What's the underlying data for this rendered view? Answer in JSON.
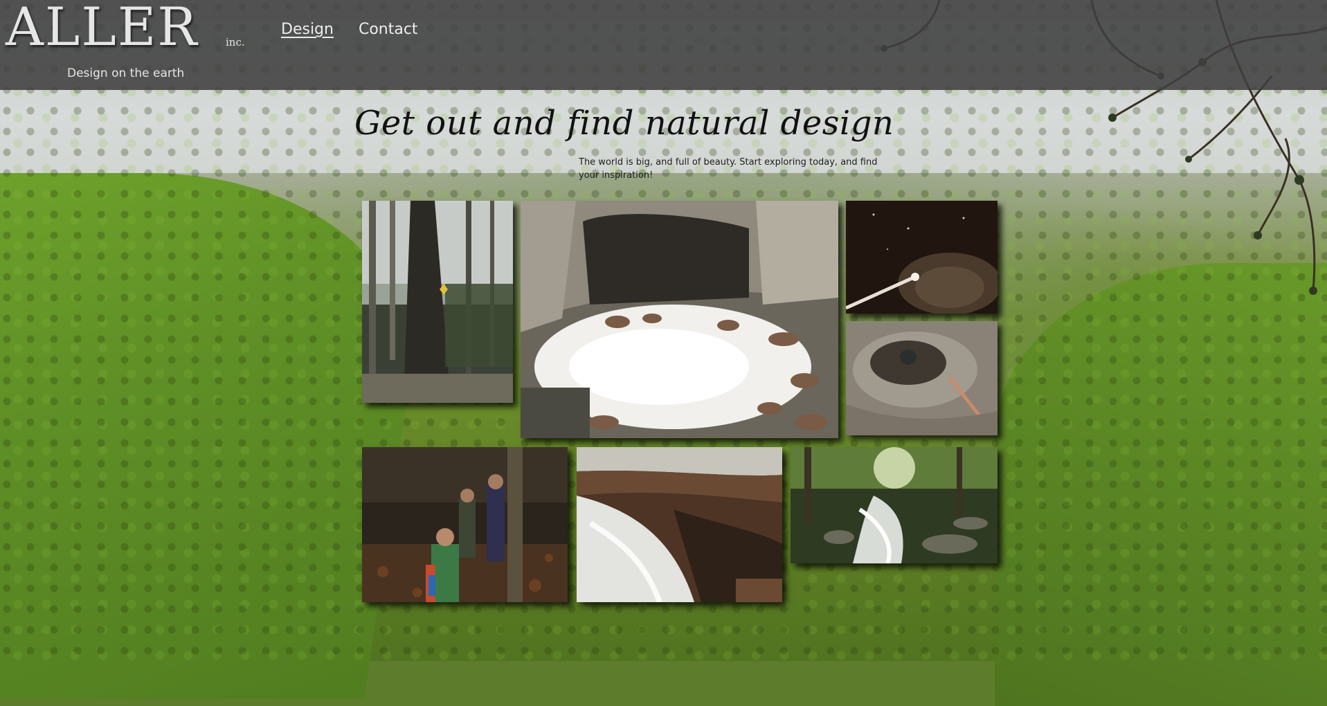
{
  "brand": {
    "name": "ALLER",
    "suffix": "inc.",
    "tagline": "Design on the earth"
  },
  "nav": {
    "items": [
      {
        "label": "Design",
        "active": true
      },
      {
        "label": "Contact",
        "active": false
      }
    ]
  },
  "hero": {
    "title": "Get out and find natural design",
    "subtitle": "The world is big, and full of beauty. Start exploring today, and find your inspiration!"
  },
  "gallery": {
    "photos": [
      {
        "subject": "forest trail with marked tree"
      },
      {
        "subject": "cave entrance with rocky stream"
      },
      {
        "subject": "caver with headlamp in dark cave"
      },
      {
        "subject": "cave passage with rope"
      },
      {
        "subject": "group of cavers in forest"
      },
      {
        "subject": "water flowing over rock ledge"
      },
      {
        "subject": "forest creek"
      }
    ]
  },
  "colors": {
    "header_bg": "#404040",
    "header_text": "#e6e6e6",
    "forest_green": "#5f8f26",
    "sky": "#d3d7d5"
  }
}
